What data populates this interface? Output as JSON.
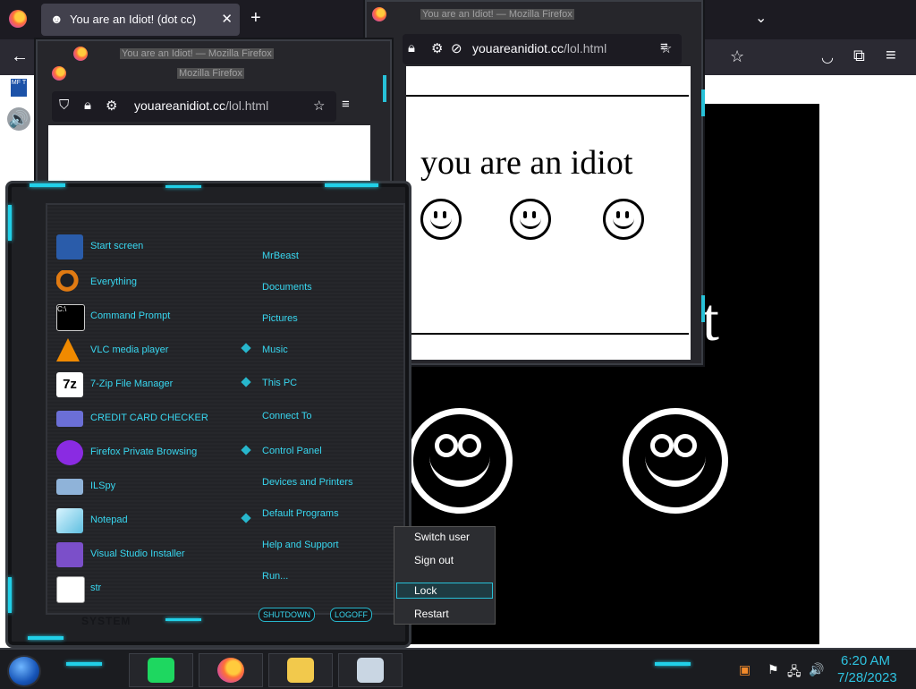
{
  "browser": {
    "tab": {
      "title": "You are an Idiot! (dot cc)",
      "icon": "smiley-icon",
      "close": "✕"
    },
    "new_tab": "+",
    "list_tabs": "⌄",
    "nav": {
      "back": "←",
      "star": "☆",
      "pocket": "pocket-icon",
      "extensions": "extensions-icon",
      "menu": "≡"
    },
    "desktop_icons": [
      {
        "label": "MF T"
      },
      {
        "label": "speaker"
      }
    ],
    "page_big_char": "t"
  },
  "popups": [
    {
      "title_line1": "You are an Idiot! — Mozilla Firefox",
      "title_line2": "Mozilla Firefox",
      "url_domain": "youareanidiot.cc",
      "url_path": "/lol.html"
    },
    {
      "title_line1": "You are an Idiot! — Mozilla Firefox",
      "url_domain": "youareanidiot.cc",
      "url_path": "/lol.html",
      "page_text": "you are an idiot"
    }
  ],
  "start_menu": {
    "programs": [
      {
        "label": "Start screen",
        "icon": "start-screen-icon",
        "color": "#2a5caa",
        "arrow": false
      },
      {
        "label": "Everything",
        "icon": "magnifier-icon",
        "color": "#e07a12",
        "arrow": false
      },
      {
        "label": "Command Prompt",
        "icon": "cmd-icon",
        "color": "#000000",
        "arrow": false
      },
      {
        "label": "VLC media player",
        "icon": "vlc-cone-icon",
        "color": "#f08a00",
        "arrow": true
      },
      {
        "label": "7-Zip File Manager",
        "icon": "7zip-icon",
        "color": "#ffffff",
        "arrow": true
      },
      {
        "label": "CREDIT CARD CHECKER",
        "icon": "credit-card-icon",
        "color": "#6b6fd6",
        "arrow": false
      },
      {
        "label": "Firefox Private Browsing",
        "icon": "private-browsing-icon",
        "color": "#8a2be2",
        "arrow": true
      },
      {
        "label": "ILSpy",
        "icon": "ilspy-icon",
        "color": "#8fb3d9",
        "arrow": false
      },
      {
        "label": "Notepad",
        "icon": "notepad-icon",
        "color": "#7fd0e6",
        "arrow": true
      },
      {
        "label": "Visual Studio Installer",
        "icon": "vs-installer-icon",
        "color": "#7b4fc9",
        "arrow": false
      },
      {
        "label": "str",
        "icon": "str-icon",
        "color": "#ffffff",
        "arrow": false
      }
    ],
    "places": [
      "MrBeast",
      "Documents",
      "Pictures",
      "Music",
      "This PC",
      "Connect To",
      "Control Panel",
      "Devices and Printers",
      "Default Programs",
      "Help and Support",
      "Run..."
    ],
    "system_label": "SYSTEM",
    "shutdown_label": "SHUTDOWN",
    "logoff_label": "LOGOFF"
  },
  "power_menu": {
    "items": [
      "Switch user",
      "Sign out",
      "Lock",
      "Restart"
    ],
    "selected": "Lock"
  },
  "taskbar": {
    "buttons": [
      {
        "name": "spotify",
        "icon": "spotify-icon",
        "color": "#1ed760"
      },
      {
        "name": "firefox",
        "icon": "firefox-icon",
        "color": "#ff7139"
      },
      {
        "name": "file-explorer",
        "icon": "folder-icon",
        "color": "#f2c94c"
      },
      {
        "name": "task-manager",
        "icon": "task-manager-icon",
        "color": "#c9d6e3"
      }
    ],
    "tray": {
      "flag": "⚑",
      "network": "network-icon",
      "volume": "🔊"
    },
    "clock": {
      "time": "6:20 AM",
      "date": "7/28/2023"
    }
  },
  "colors": {
    "accent": "#27c1d8",
    "menu_text": "#38d7f0"
  }
}
